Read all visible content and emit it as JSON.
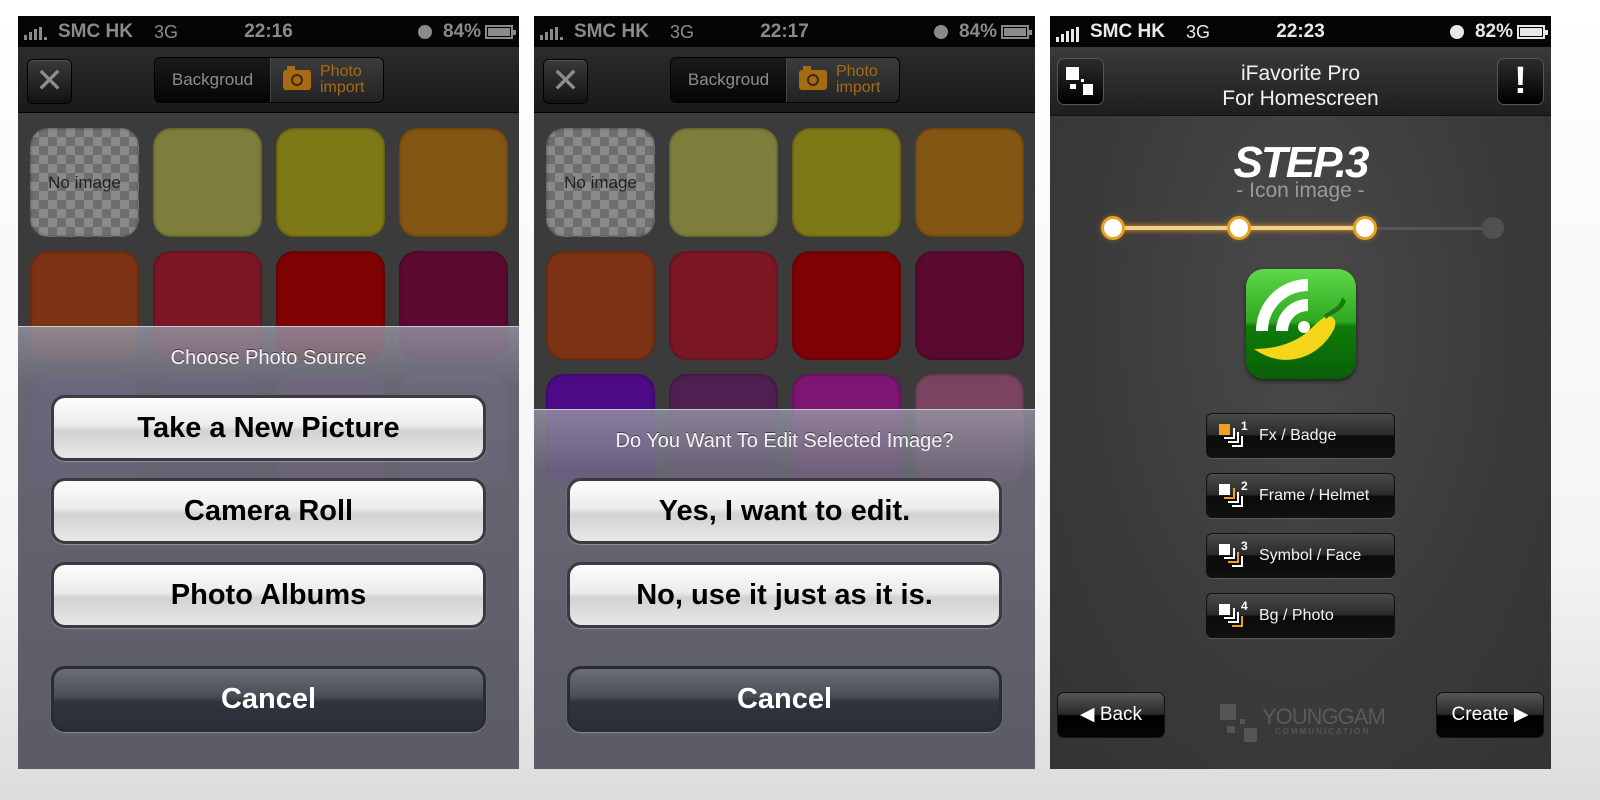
{
  "screens": [
    {
      "status": {
        "carrier": "SMC HK",
        "network": "3G",
        "time": "22:16",
        "battery": "84%"
      },
      "nav": {
        "segments": [
          "Backgroud",
          "Photo import"
        ],
        "segment_active": "Photo import",
        "segment2_line1": "Photo",
        "segment2_line2": "import"
      },
      "tiles": [
        {
          "label": "No image",
          "color": "checker"
        },
        {
          "label": "",
          "color": "#7d7d3c"
        },
        {
          "label": "",
          "color": "#7f7817"
        },
        {
          "label": "",
          "color": "#835611"
        },
        {
          "label": "",
          "color": "#7c3214"
        },
        {
          "label": "",
          "color": "#7b1624"
        },
        {
          "label": "",
          "color": "#7f0204"
        },
        {
          "label": "",
          "color": "#5c0930"
        }
      ],
      "sheet": {
        "title": "Choose Photo Source",
        "buttons": [
          "Take a New Picture",
          "Camera Roll",
          "Photo Albums"
        ],
        "cancel": "Cancel"
      }
    },
    {
      "status": {
        "carrier": "SMC HK",
        "network": "3G",
        "time": "22:17",
        "battery": "84%"
      },
      "nav": {
        "segments": [
          "Backgroud",
          "Photo import"
        ],
        "segment_active": "Photo import",
        "segment2_line1": "Photo",
        "segment2_line2": "import"
      },
      "tiles": [
        {
          "label": "No image",
          "color": "checker"
        },
        {
          "label": "",
          "color": "#7d7d3c"
        },
        {
          "label": "",
          "color": "#7f7817"
        },
        {
          "label": "",
          "color": "#835611"
        },
        {
          "label": "",
          "color": "#7c3214"
        },
        {
          "label": "",
          "color": "#7b1624"
        },
        {
          "label": "",
          "color": "#7f0204"
        },
        {
          "label": "",
          "color": "#5c0930"
        },
        {
          "label": "",
          "color": "#4c0a86"
        },
        {
          "label": "",
          "color": "#4e1f50"
        },
        {
          "label": "",
          "color": "#7d1572"
        },
        {
          "label": "",
          "color": "#7a4460"
        }
      ],
      "sheet": {
        "title": "Do You Want To Edit Selected Image?",
        "buttons": [
          "Yes, I want to edit.",
          "No, use it just as it is."
        ],
        "cancel": "Cancel"
      }
    },
    {
      "status": {
        "carrier": "SMC HK",
        "network": "3G",
        "time": "22:23",
        "battery": "82%"
      },
      "nav": {
        "title_line1": "iFavorite Pro",
        "title_line2": "For Homescreen",
        "info_label": "!"
      },
      "step": {
        "title": "STEP.3",
        "subtitle": "- Icon image -",
        "current": 3,
        "total": 4
      },
      "accent": "#f0a020",
      "menu": [
        {
          "num": "1",
          "label": "Fx / Badge"
        },
        {
          "num": "2",
          "label": "Frame / Helmet"
        },
        {
          "num": "3",
          "label": "Symbol / Face"
        },
        {
          "num": "4",
          "label": "Bg / Photo"
        }
      ],
      "footer": {
        "back": "◀ Back",
        "create": "Create ▶",
        "brand": "YOUNGGAM",
        "brand_sub": "COMMUNICATION"
      }
    }
  ]
}
